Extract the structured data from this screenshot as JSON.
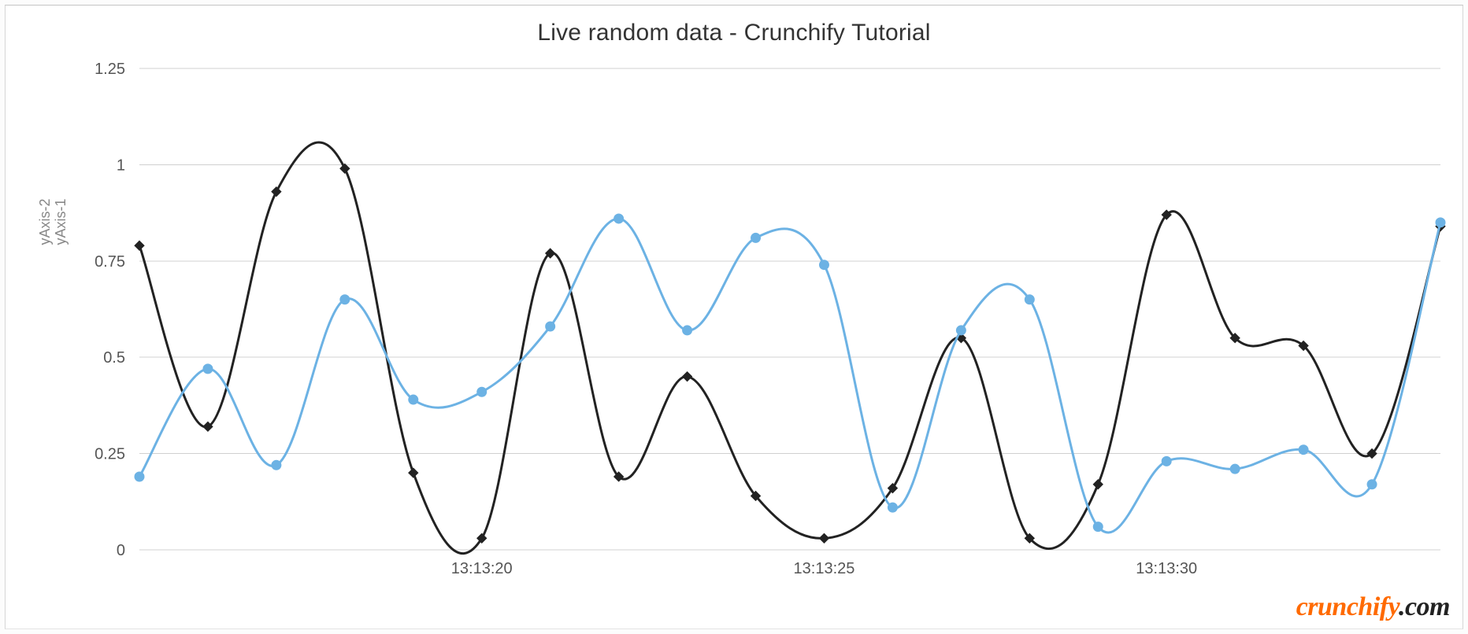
{
  "title": "Live random data - Crunchify Tutorial",
  "y_axis_label_1": "yAxis-1",
  "y_axis_label_2": "yAxis-2",
  "logo_part1": "crunchify",
  "logo_part2": ".com",
  "chart_data": {
    "type": "line",
    "title": "Live random data - Crunchify Tutorial",
    "xlabel": "",
    "ylabel": "yAxis-1 / yAxis-2",
    "ylim": [
      0,
      1.25
    ],
    "y_ticks": [
      0,
      0.25,
      0.5,
      0.75,
      1,
      1.25
    ],
    "x_tick_labels": [
      "13:13:20",
      "13:13:25",
      "13:13:30"
    ],
    "x_tick_positions": [
      5,
      10,
      15
    ],
    "x_range_count": 20,
    "series": [
      {
        "name": "yAxis-1",
        "color": "#222222",
        "marker": "diamond",
        "values": [
          0.79,
          0.32,
          0.93,
          0.99,
          0.2,
          0.03,
          0.77,
          0.19,
          0.45,
          0.14,
          0.03,
          0.16,
          0.55,
          0.03,
          0.17,
          0.87,
          0.55,
          0.53,
          0.25,
          0.84
        ]
      },
      {
        "name": "yAxis-2",
        "color": "#6cb2e4",
        "marker": "circle",
        "values": [
          0.19,
          0.47,
          0.22,
          0.65,
          0.39,
          0.41,
          0.58,
          0.86,
          0.57,
          0.81,
          0.74,
          0.11,
          0.57,
          0.65,
          0.06,
          0.23,
          0.21,
          0.26,
          0.17,
          0.85
        ]
      }
    ]
  }
}
